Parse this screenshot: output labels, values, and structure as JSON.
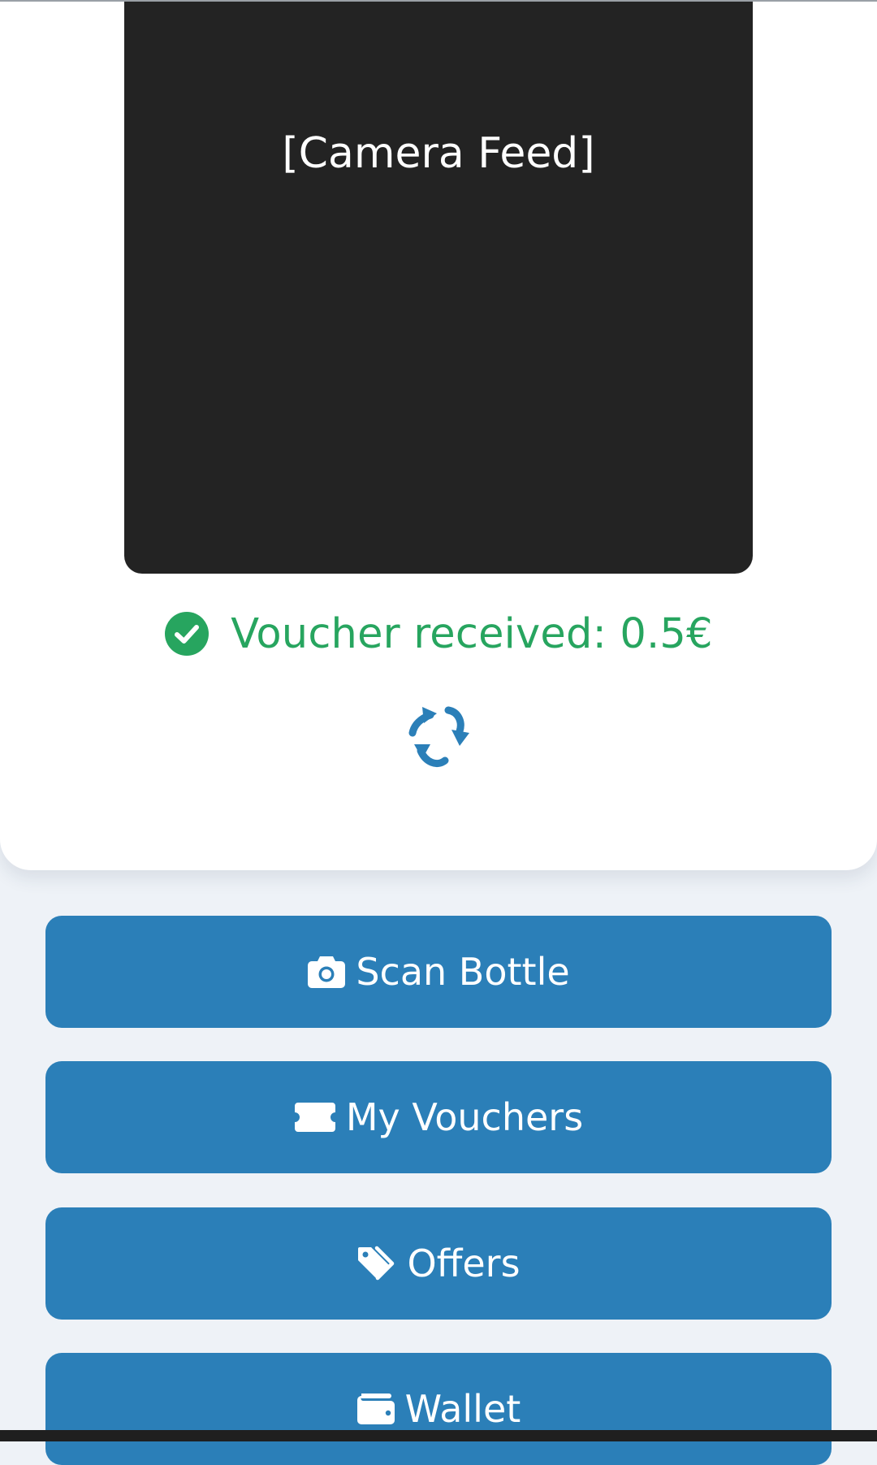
{
  "camera": {
    "label": "[Camera Feed]"
  },
  "status": {
    "text": "Voucher received: 0.5€",
    "icon": "check-circle-icon",
    "color": "#27a55f"
  },
  "recycle": {
    "icon": "recycle-icon",
    "color": "#2b7fb8"
  },
  "actions": {
    "scan_bottle": {
      "label": "Scan Bottle",
      "icon": "camera-icon"
    },
    "my_vouchers": {
      "label": "My Vouchers",
      "icon": "ticket-icon"
    },
    "offers": {
      "label": "Offers",
      "icon": "tags-icon"
    },
    "wallet": {
      "label": "Wallet",
      "icon": "wallet-icon"
    }
  },
  "colors": {
    "accent": "#2b7fb8",
    "success": "#27a55f",
    "page_background": "#eef2f7",
    "camera_background": "#232323"
  }
}
